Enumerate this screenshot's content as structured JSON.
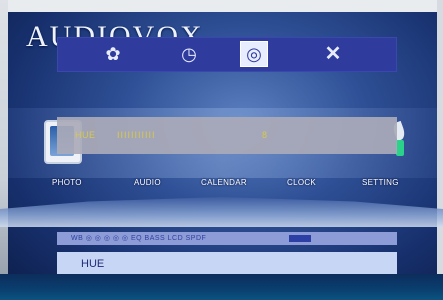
{
  "brand": "AUDIOVOX",
  "toolbar": {
    "items": [
      {
        "icon": "gear-icon",
        "glyph": "✿"
      },
      {
        "icon": "clock-icon",
        "glyph": "◷"
      },
      {
        "icon": "display-settings-icon",
        "glyph": "◎",
        "selected": true
      },
      {
        "icon": "close-icon",
        "glyph": "✕"
      }
    ]
  },
  "hue_overlay": {
    "label": "HUE",
    "bar": "IIIIIIIIIII",
    "value": "8"
  },
  "menu": {
    "items": [
      "PHOTO",
      "AUDIO",
      "CALENDAR",
      "CLOCK",
      "SETTING"
    ]
  },
  "info_strip": {
    "text": "WB  ◎  ◎  ◎  ◎  ◎  EQ  BASS  LCD  SPDF"
  },
  "status": {
    "label": "HUE"
  }
}
